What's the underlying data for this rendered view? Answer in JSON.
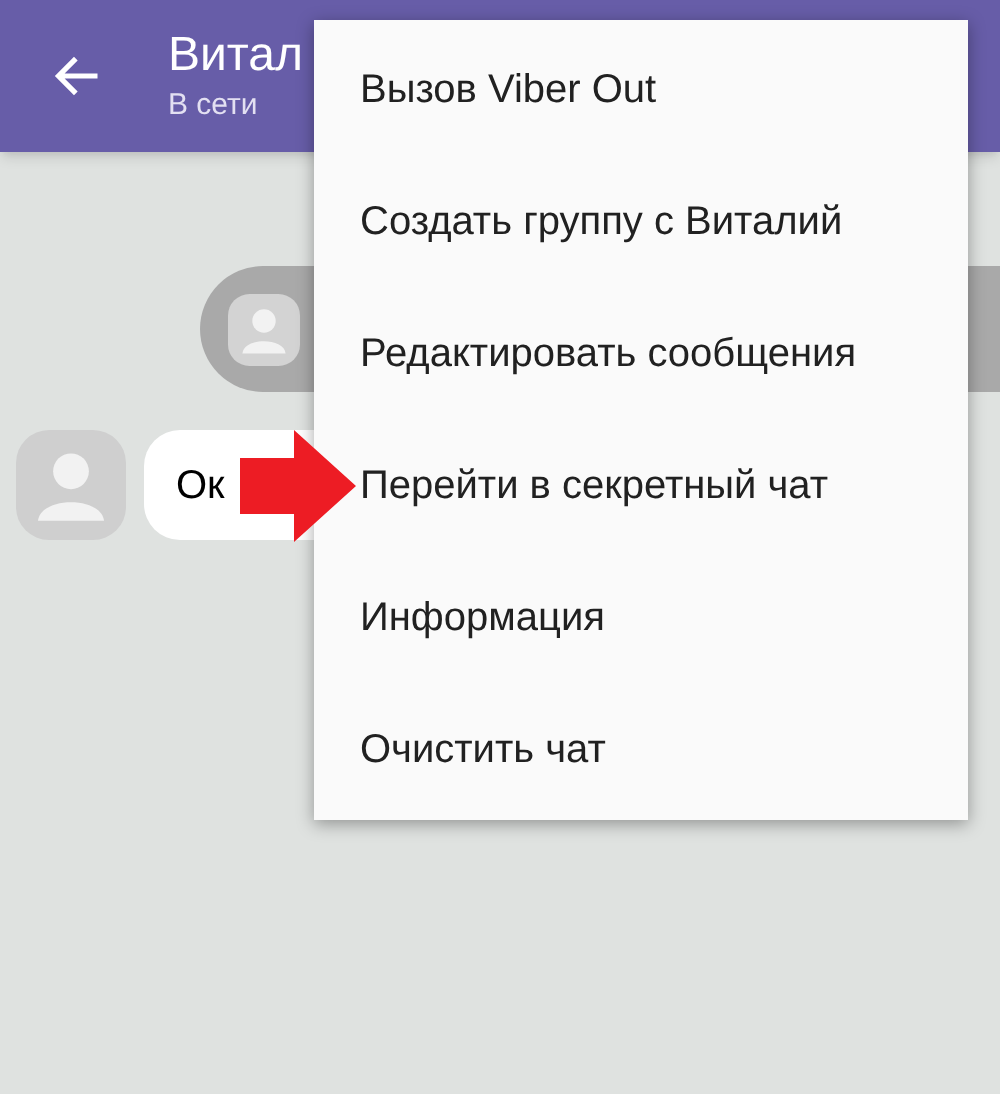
{
  "header": {
    "title": "Витал",
    "status": "В сети"
  },
  "messages": [
    {
      "kind": "outgoing-image"
    },
    {
      "kind": "incoming",
      "text": "Ок"
    }
  ],
  "menu": {
    "items": [
      {
        "label": "Вызов Viber Out"
      },
      {
        "label": "Создать группу с Виталий"
      },
      {
        "label": "Редактировать сообщения"
      },
      {
        "label": "Перейти в секретный чат"
      },
      {
        "label": "Информация"
      },
      {
        "label": "Очистить чат"
      }
    ]
  }
}
